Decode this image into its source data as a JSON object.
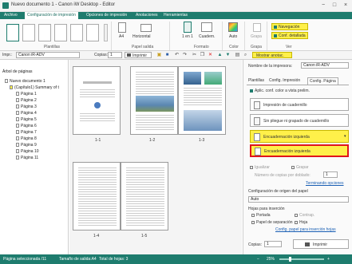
{
  "window": {
    "title": "Nuevo documento 1 - Canon iW Desktop - Editor",
    "min": "−",
    "max": "□",
    "close": "×"
  },
  "ribbon_tabs": [
    "Archivo",
    "Configuración de impresión",
    "Opciones de impresión",
    "Anotaciones",
    "Herramientas"
  ],
  "ribbon": {
    "groups": [
      "Plantillas",
      "Papel salida",
      "Formato",
      "Color",
      "Grapa",
      "Ver"
    ],
    "paper_size": "A4",
    "orientation": "Horizontal",
    "pages_per_sheet": "1 en 1",
    "binding": "Cuadern.",
    "color_mode": "Auto",
    "staple": "Grapa",
    "navigation": "Navegación",
    "detailed_config": "Conf. detallada"
  },
  "toolbar": {
    "printer_label": "Impr.:",
    "printer_value": "Canon iR-ADV",
    "copies_label": "Copias:",
    "copies_value": "1",
    "print_button": "Imprimir",
    "show_annotations": "Mostrar anotac."
  },
  "tree": {
    "header": "Árbol de páginas",
    "root": "Nuevo documento 1",
    "doc": "(Capítulo1) Summary of t",
    "pages": [
      "Página 1",
      "Página 2",
      "Página 3",
      "Página 4",
      "Página 5",
      "Página 6",
      "Página 7",
      "Página 8",
      "Página 9",
      "Página 10",
      "Página 11"
    ]
  },
  "pages": [
    "1-1",
    "1-2",
    "1-3",
    "1-4",
    "1-5"
  ],
  "panel": {
    "printer_name_label": "Nombre de la impresora:",
    "printer_name_value": "Canon iR-ADV",
    "tabs": [
      "Plantillas",
      "Config. Impresión",
      "Config. Página"
    ],
    "apply_color": "Aplic. conf. color a vista prelim.",
    "options": [
      "Impresión de cuadernillo",
      "Sin pliegue ni grapado de cuadernillo",
      "Encuadernación izquierda"
    ],
    "dropdown_item": "Encuadernación izquierda",
    "equalize": "Igualizar",
    "staple_opt": "Grapar",
    "copies_per_fold": "Número de copias por doblado:",
    "copies_per_fold_value": "1",
    "finishing_link": "Terminando opciones",
    "paper_source_label": "Configuración de origen del papel",
    "paper_source_value": "Auto",
    "insert_label": "Hojas para inserción",
    "cover": "Portada",
    "back_cover": "Contrap.",
    "separator": "Papel de separación",
    "sheet": "Hoja",
    "insert_link": "Config. papel para inserción hojas",
    "copies_label": "Copias:",
    "copies_value": "1",
    "print_button": "Imprimir"
  },
  "status": {
    "selected": "Página seleccionada /11",
    "output_size": "Tamaño de salida:A4",
    "sheets": "Total de hojas: 3",
    "zoom": "25%"
  },
  "colors": {
    "accent": "#1e7c6e",
    "highlight": "#fff04a",
    "red": "#e0141c"
  }
}
